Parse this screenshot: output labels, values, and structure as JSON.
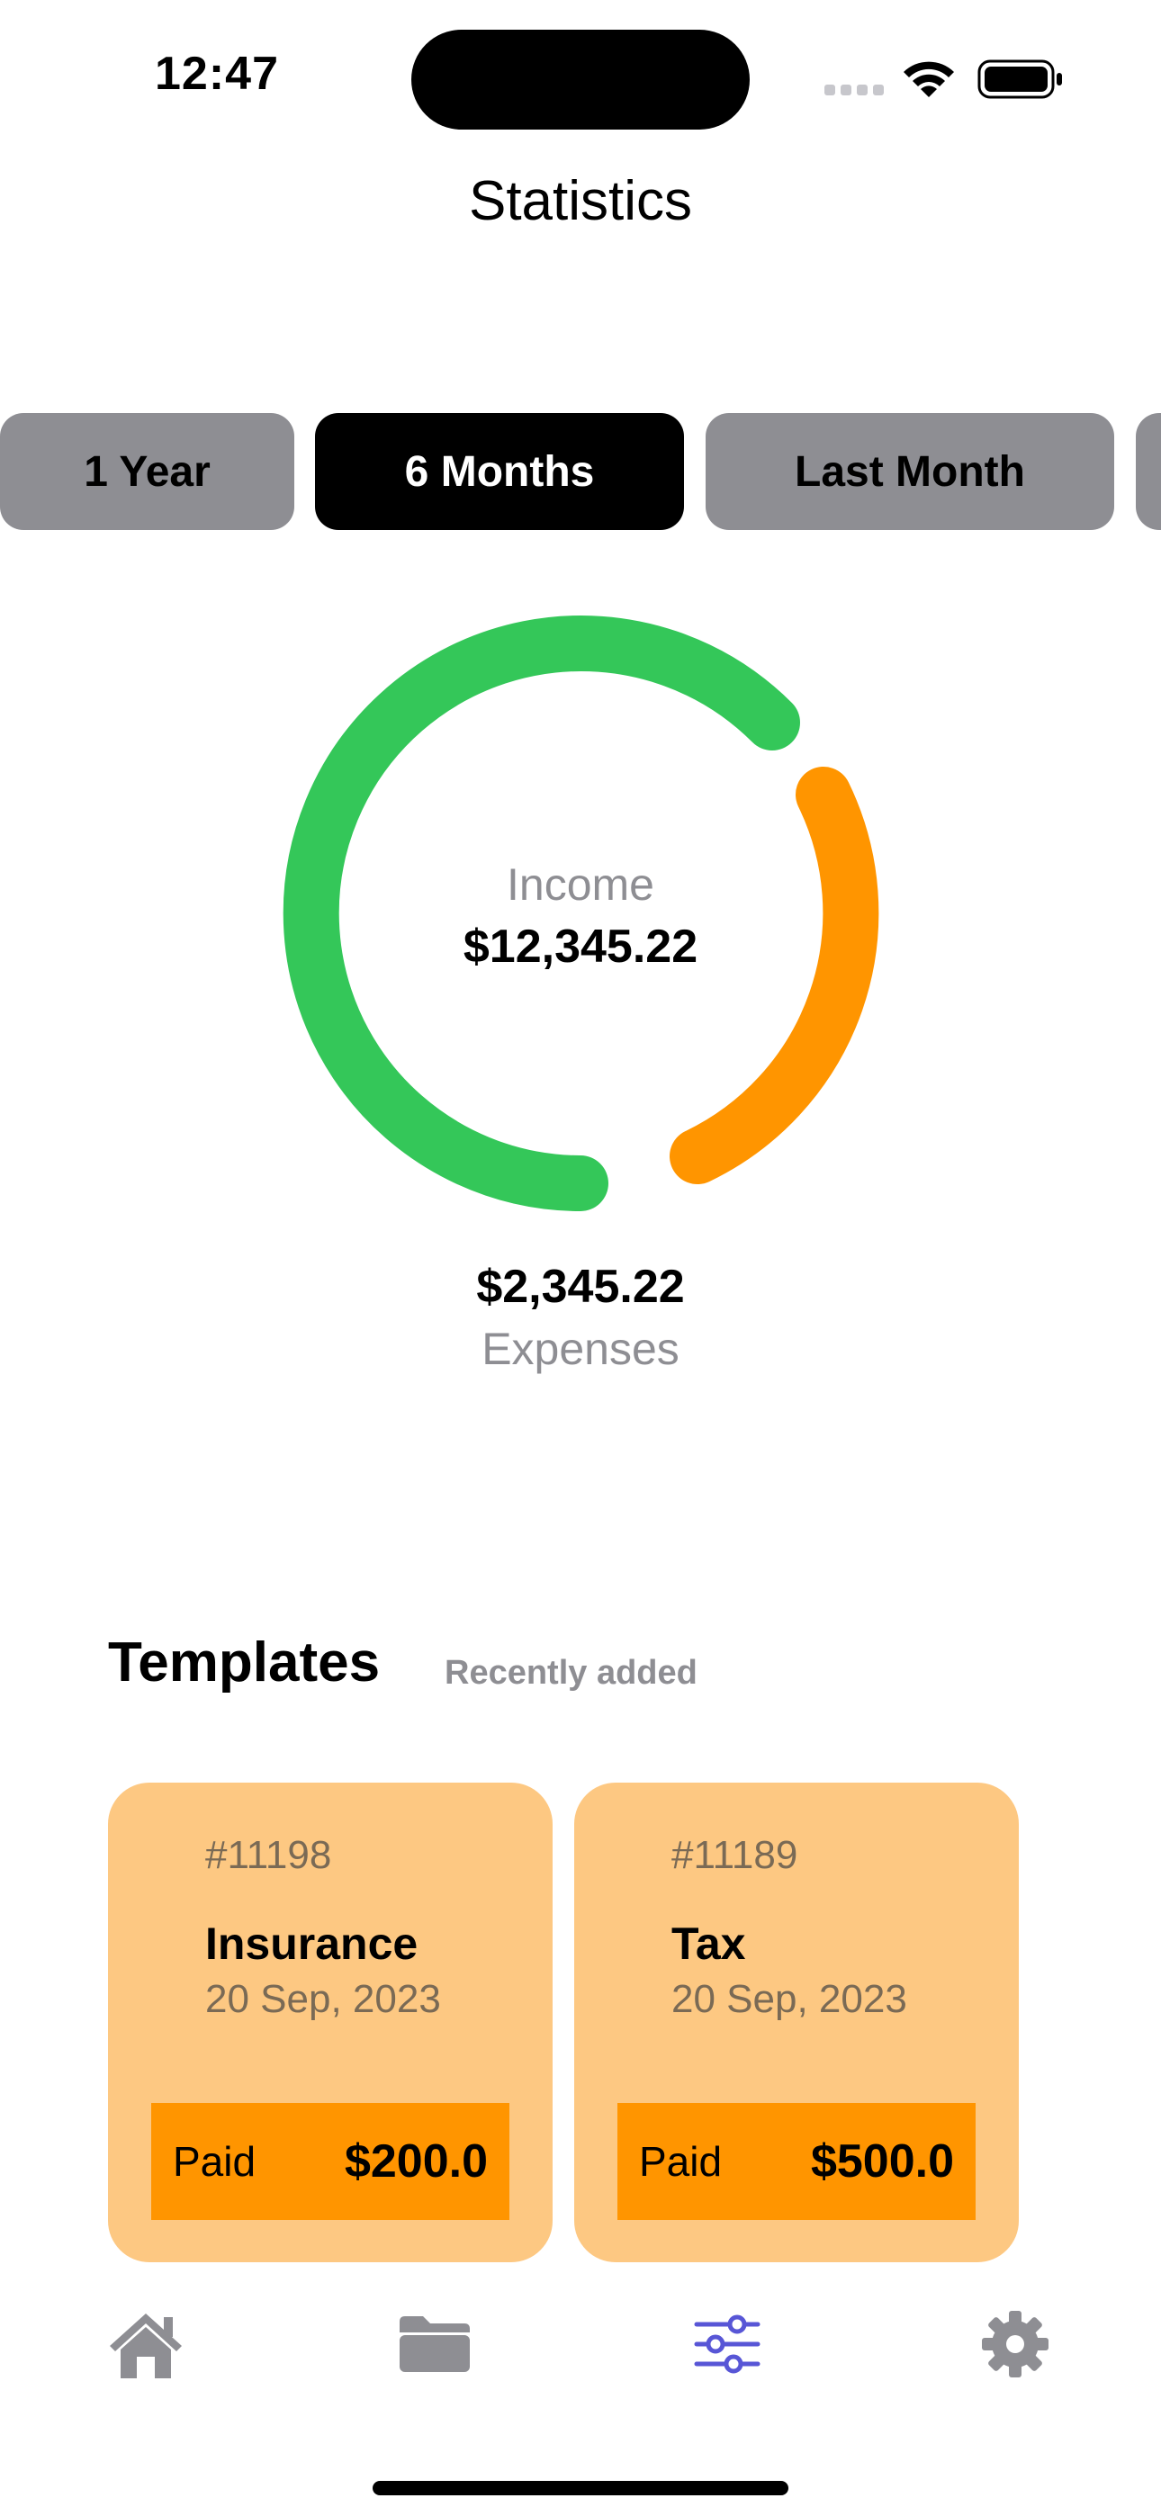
{
  "status_bar": {
    "time": "12:47"
  },
  "header": {
    "title": "Statistics"
  },
  "period_tabs": [
    {
      "label": "1 Year",
      "active": false
    },
    {
      "label": "6 Months",
      "active": true
    },
    {
      "label": "Last Month",
      "active": false
    },
    {
      "label": "",
      "active": false
    }
  ],
  "summary": {
    "income_label": "Income",
    "income_value": "$12,345.22",
    "expenses_value": "$2,345.22",
    "expenses_label": "Expenses",
    "colors": {
      "income": "#34c759",
      "expenses": "#ff9500"
    }
  },
  "templates": {
    "title": "Templates",
    "subtitle": "Recently added",
    "cards": [
      {
        "id": "#11198",
        "name": "Insurance",
        "date": "20 Sep, 2023",
        "status": "Paid",
        "amount": "$200.0"
      },
      {
        "id": "#11189",
        "name": "Tax",
        "date": "20 Sep, 2023",
        "status": "Paid",
        "amount": "$500.0"
      }
    ]
  },
  "tab_bar": {
    "items": [
      {
        "icon": "home-icon",
        "active": false
      },
      {
        "icon": "folder-icon",
        "active": false
      },
      {
        "icon": "sliders-icon",
        "active": true
      },
      {
        "icon": "gear-icon",
        "active": false
      }
    ],
    "active_color": "#5856d6",
    "inactive_color": "#8e8e93"
  }
}
